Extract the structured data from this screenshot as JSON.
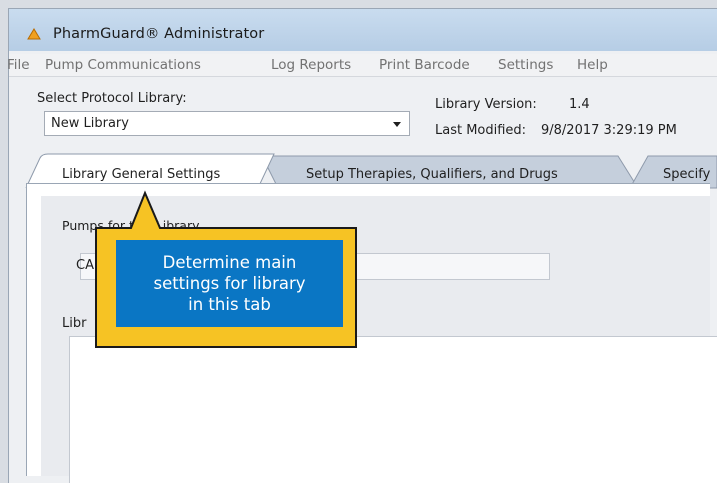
{
  "window": {
    "title": "PharmGuard® Administrator"
  },
  "menu": {
    "items": [
      "File",
      "Pump Communications",
      "Log Reports",
      "Print Barcode",
      "Settings",
      "Help"
    ]
  },
  "protocol_library": {
    "label": "Select Protocol Library:",
    "selected": "New Library",
    "version_label": "Library Version:",
    "version_value": "1.4",
    "modified_label": "Last Modified:",
    "modified_value": "9/8/2017 3:29:19 PM"
  },
  "tabs": [
    {
      "label": "Library General Settings",
      "active": true
    },
    {
      "label": "Setup Therapies, Qualifiers, and Drugs",
      "active": false
    },
    {
      "label": "Specify",
      "active": false
    }
  ],
  "general": {
    "pumps_label": "Pumps for this Library",
    "pumps_value": "CA",
    "library_label": "Libr"
  },
  "callout": {
    "text": "Determine main\nsettings for library\nin this tab",
    "fill_color": "#0a76c4",
    "border_color": "#f6c324"
  }
}
